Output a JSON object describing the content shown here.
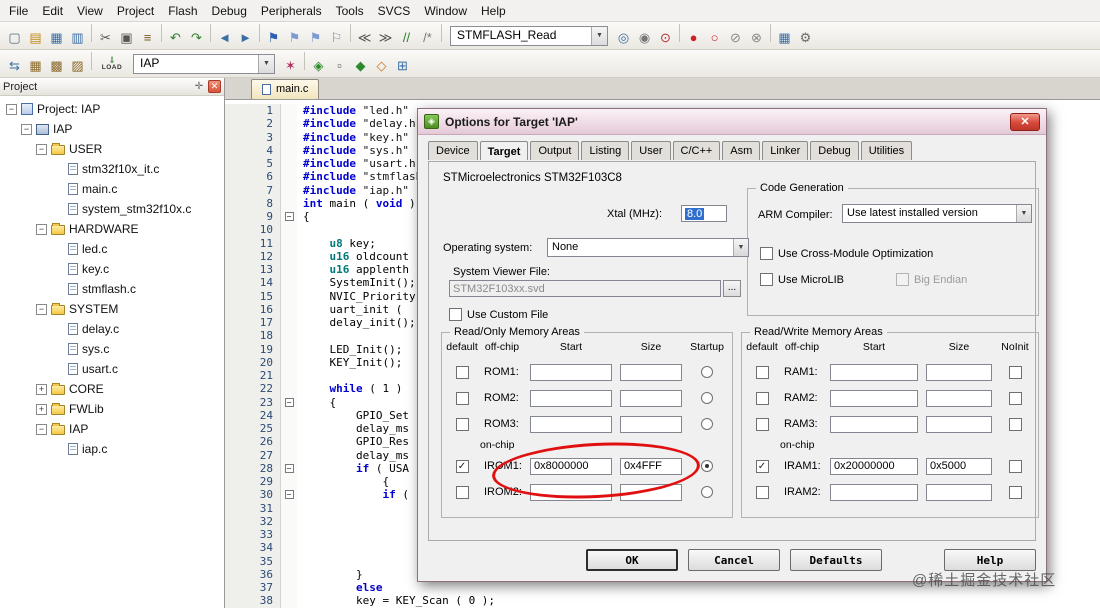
{
  "menu": {
    "items": [
      "File",
      "Edit",
      "View",
      "Project",
      "Flash",
      "Debug",
      "Peripherals",
      "Tools",
      "SVCS",
      "Window",
      "Help"
    ]
  },
  "toolbar_main": {
    "icons_left": [
      {
        "name": "new-file-icon",
        "glyph": "▢",
        "color": "#5a6b7d"
      },
      {
        "name": "open-folder-icon",
        "glyph": "▤",
        "color": "#c08a18"
      },
      {
        "name": "save-icon",
        "glyph": "▦",
        "color": "#3a6ea5"
      },
      {
        "name": "save-all-icon",
        "glyph": "▥",
        "color": "#3a6ea5"
      },
      {
        "sep": true
      },
      {
        "name": "cut-icon",
        "glyph": "✂",
        "color": "#555555"
      },
      {
        "name": "copy-icon",
        "glyph": "▣",
        "color": "#555555"
      },
      {
        "name": "paste-icon",
        "glyph": "≡",
        "color": "#7a5c22"
      },
      {
        "sep": true
      },
      {
        "name": "undo-icon",
        "glyph": "↶",
        "color": "#2d7d2d"
      },
      {
        "name": "redo-icon",
        "glyph": "↷",
        "color": "#2d7d2d"
      },
      {
        "sep": true
      },
      {
        "name": "nav-back-icon",
        "glyph": "◄",
        "color": "#3a6ea5"
      },
      {
        "name": "nav-forward-icon",
        "glyph": "►",
        "color": "#3a6ea5"
      },
      {
        "sep": true
      },
      {
        "name": "bookmark-icon",
        "glyph": "⚑",
        "color": "#2b5fb0"
      },
      {
        "name": "prev-bookmark-icon",
        "glyph": "⚑",
        "color": "#7d9bd0"
      },
      {
        "name": "next-bookmark-icon",
        "glyph": "⚑",
        "color": "#7d9bd0"
      },
      {
        "name": "clear-bookmarks-icon",
        "glyph": "⚐",
        "color": "#8a8a8a"
      },
      {
        "sep": true
      },
      {
        "name": "outdent-icon",
        "glyph": "≪",
        "color": "#555555"
      },
      {
        "name": "indent-icon",
        "glyph": "≫",
        "color": "#555555"
      },
      {
        "name": "comment-icon",
        "glyph": "//",
        "color": "#2d7d2d"
      },
      {
        "name": "uncomment-icon",
        "glyph": "/*",
        "color": "#777777"
      },
      {
        "sep": true
      }
    ],
    "search_combo": {
      "value": "STMFLASH_Read"
    },
    "icons_right": [
      {
        "name": "find-in-files-icon",
        "glyph": "◎",
        "color": "#3a6ea5"
      },
      {
        "name": "find-icon",
        "glyph": "◉",
        "color": "#777777"
      },
      {
        "name": "incremental-find-icon",
        "glyph": "⊙",
        "color": "#b03030"
      },
      {
        "sep": true
      },
      {
        "name": "breakpoint-icon",
        "glyph": "●",
        "color": "#cc2222"
      },
      {
        "name": "toggle-breakpoint-icon",
        "glyph": "○",
        "color": "#cc2222"
      },
      {
        "name": "disable-breakpoints-icon",
        "glyph": "⊘",
        "color": "#888888"
      },
      {
        "name": "kill-breakpoints-icon",
        "glyph": "⊗",
        "color": "#888888"
      },
      {
        "sep": true
      },
      {
        "name": "window-layout-icon",
        "glyph": "▦",
        "color": "#3a6ea5"
      },
      {
        "name": "configure-wrench-icon",
        "glyph": "⚙",
        "color": "#6a6a6a"
      }
    ]
  },
  "toolbar_build": {
    "icons_left": [
      {
        "name": "translate-file-icon",
        "glyph": "⇆",
        "color": "#3a6ea5"
      },
      {
        "name": "build-icon",
        "glyph": "▦",
        "color": "#8a6a2a"
      },
      {
        "name": "rebuild-icon",
        "glyph": "▩",
        "color": "#8a6a2a"
      },
      {
        "name": "batch-build-icon",
        "glyph": "▨",
        "color": "#8a6a2a"
      },
      {
        "sep": true
      }
    ],
    "load_label": "LOAD",
    "target_combo": {
      "value": "IAP"
    },
    "icons_right": [
      {
        "name": "options-for-target-icon",
        "glyph": "✶",
        "color": "#b03060"
      },
      {
        "sep": true
      },
      {
        "name": "manage-runtime-environment-icon",
        "glyph": "◈",
        "color": "#2d8a2d"
      },
      {
        "name": "file-extensions-icon",
        "glyph": "▫",
        "color": "#555555"
      },
      {
        "name": "manage-components-icon",
        "glyph": "◆",
        "color": "#2d8a2d"
      },
      {
        "name": "select-software-packs-icon",
        "glyph": "◇",
        "color": "#d07020"
      },
      {
        "name": "pack-installer-icon",
        "glyph": "⊞",
        "color": "#3a6ea5"
      }
    ]
  },
  "project_panel": {
    "title": "Project",
    "tree": [
      {
        "label": "Project: IAP",
        "level": 0,
        "icon": "workspace",
        "expand": "minus"
      },
      {
        "label": "IAP",
        "level": 1,
        "icon": "target",
        "expand": "minus"
      },
      {
        "label": "USER",
        "level": 2,
        "icon": "folder",
        "expand": "minus"
      },
      {
        "label": "stm32f10x_it.c",
        "level": 3,
        "icon": "file",
        "expand": "none"
      },
      {
        "label": "main.c",
        "level": 3,
        "icon": "file",
        "expand": "none"
      },
      {
        "label": "system_stm32f10x.c",
        "level": 3,
        "icon": "file",
        "expand": "none"
      },
      {
        "label": "HARDWARE",
        "level": 2,
        "icon": "folder",
        "expand": "minus"
      },
      {
        "label": "led.c",
        "level": 3,
        "icon": "file",
        "expand": "none"
      },
      {
        "label": "key.c",
        "level": 3,
        "icon": "file",
        "expand": "none"
      },
      {
        "label": "stmflash.c",
        "level": 3,
        "icon": "file",
        "expand": "none"
      },
      {
        "label": "SYSTEM",
        "level": 2,
        "icon": "folder",
        "expand": "minus"
      },
      {
        "label": "delay.c",
        "level": 3,
        "icon": "file",
        "expand": "none"
      },
      {
        "label": "sys.c",
        "level": 3,
        "icon": "file",
        "expand": "none"
      },
      {
        "label": "usart.c",
        "level": 3,
        "icon": "file",
        "expand": "none"
      },
      {
        "label": "CORE",
        "level": 2,
        "icon": "folder",
        "expand": "plus"
      },
      {
        "label": "FWLib",
        "level": 2,
        "icon": "folder",
        "expand": "plus"
      },
      {
        "label": "IAP",
        "level": 2,
        "icon": "folder",
        "expand": "minus"
      },
      {
        "label": "iap.c",
        "level": 3,
        "icon": "file",
        "expand": "none"
      }
    ]
  },
  "editor": {
    "tab": "main.c",
    "fold_lines": [
      9,
      23,
      28,
      30
    ],
    "lines": [
      {
        "n": 1,
        "text": "#include \"led.h\""
      },
      {
        "n": 2,
        "text": "#include \"delay.h\""
      },
      {
        "n": 3,
        "text": "#include \"key.h\""
      },
      {
        "n": 4,
        "text": "#include \"sys.h\""
      },
      {
        "n": 5,
        "text": "#include \"usart.h\""
      },
      {
        "n": 6,
        "text": "#include \"stmflash.h\""
      },
      {
        "n": 7,
        "text": "#include \"iap.h\""
      },
      {
        "n": 8,
        "text": "int main ( void )"
      },
      {
        "n": 9,
        "text": "{"
      },
      {
        "n": 10,
        "text": ""
      },
      {
        "n": 11,
        "text": "    u8 key;"
      },
      {
        "n": 12,
        "text": "    u16 oldcount"
      },
      {
        "n": 13,
        "text": "    u16 applenth"
      },
      {
        "n": 14,
        "text": "    SystemInit();"
      },
      {
        "n": 15,
        "text": "    NVIC_Priority"
      },
      {
        "n": 16,
        "text": "    uart_init ("
      },
      {
        "n": 17,
        "text": "    delay_init();"
      },
      {
        "n": 18,
        "text": ""
      },
      {
        "n": 19,
        "text": "    LED_Init();"
      },
      {
        "n": 20,
        "text": "    KEY_Init();"
      },
      {
        "n": 21,
        "text": ""
      },
      {
        "n": 22,
        "text": "    while ( 1 )"
      },
      {
        "n": 23,
        "text": "    {"
      },
      {
        "n": 24,
        "text": "        GPIO_Set"
      },
      {
        "n": 25,
        "text": "        delay_ms"
      },
      {
        "n": 26,
        "text": "        GPIO_Res"
      },
      {
        "n": 27,
        "text": "        delay_ms"
      },
      {
        "n": 28,
        "text": "        if ( USA"
      },
      {
        "n": 29,
        "text": "            {"
      },
      {
        "n": 30,
        "text": "            if ("
      },
      {
        "n": 31,
        "text": ""
      },
      {
        "n": 32,
        "text": ""
      },
      {
        "n": 33,
        "text": ""
      },
      {
        "n": 34,
        "text": ""
      },
      {
        "n": 35,
        "text": ""
      },
      {
        "n": 36,
        "text": "        }"
      },
      {
        "n": 37,
        "text": "        else"
      },
      {
        "n": 38,
        "text": "        key = KEY_Scan ( 0 );"
      }
    ]
  },
  "dialog": {
    "title": "Options for Target 'IAP'",
    "tabs": [
      "Device",
      "Target",
      "Output",
      "Listing",
      "User",
      "C/C++",
      "Asm",
      "Linker",
      "Debug",
      "Utilities"
    ],
    "active_tab": "Target",
    "device_label": "STMicroelectronics STM32F103C8",
    "xtal_label": "Xtal (MHz):",
    "xtal_value": "8.0",
    "os_label": "Operating system:",
    "os_value": "None",
    "svd_label": "System Viewer File:",
    "svd_value": "STM32F103xx.svd",
    "browse_label": "...",
    "use_custom_file_label": "Use Custom File",
    "codegen": {
      "title": "Code Generation",
      "arm_compiler_label": "ARM Compiler:",
      "arm_compiler_value": "Use latest installed version",
      "cross_module_label": "Use Cross-Module Optimization",
      "microlib_label": "Use MicroLIB",
      "big_endian_label": "Big Endian"
    },
    "rom": {
      "title": "Read/Only Memory Areas",
      "headers": [
        "default",
        "off-chip",
        "Start",
        "Size",
        "Startup"
      ],
      "rows": [
        {
          "label": "ROM1:",
          "checked": false,
          "start": "",
          "size": "",
          "sel": false
        },
        {
          "label": "ROM2:",
          "checked": false,
          "start": "",
          "size": "",
          "sel": false
        },
        {
          "label": "ROM3:",
          "checked": false,
          "start": "",
          "size": "",
          "sel": false
        },
        {
          "divider": "on-chip"
        },
        {
          "label": "IROM1:",
          "checked": true,
          "start": "0x8000000",
          "size": "0x4FFF",
          "sel": true
        },
        {
          "label": "IROM2:",
          "checked": false,
          "start": "",
          "size": "",
          "sel": false
        }
      ]
    },
    "ram": {
      "title": "Read/Write Memory Areas",
      "headers": [
        "default",
        "off-chip",
        "Start",
        "Size",
        "NoInit"
      ],
      "rows": [
        {
          "label": "RAM1:",
          "checked": false,
          "start": "",
          "size": ""
        },
        {
          "label": "RAM2:",
          "checked": false,
          "start": "",
          "size": ""
        },
        {
          "label": "RAM3:",
          "checked": false,
          "start": "",
          "size": ""
        },
        {
          "divider": "on-chip"
        },
        {
          "label": "IRAM1:",
          "checked": true,
          "start": "0x20000000",
          "size": "0x5000"
        },
        {
          "label": "IRAM2:",
          "checked": false,
          "start": "",
          "size": ""
        }
      ]
    },
    "buttons": [
      "OK",
      "Cancel",
      "Defaults",
      "Help"
    ]
  },
  "watermark": "@稀土掘金技术社区"
}
